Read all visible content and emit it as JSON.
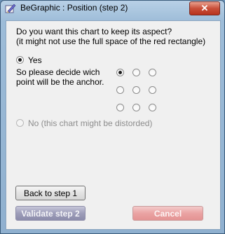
{
  "window": {
    "title": "BeGraphic : Position (step 2)",
    "close_label": "✕"
  },
  "question": {
    "line1": "Do you want this chart to keep its aspect?",
    "line2": "(it might not use the full space of the red rectangle)"
  },
  "options": {
    "yes_label": "Yes",
    "yes_selected": true,
    "anchor_prompt_line1": "So please decide wich",
    "anchor_prompt_line2": "point will be the anchor.",
    "anchor_selected": "top-left",
    "no_label": "No (this chart might be distorded)",
    "no_enabled": false
  },
  "buttons": {
    "back_label": "Back to step 1",
    "validate_label": "Validate step 2",
    "cancel_label": "Cancel"
  },
  "colors": {
    "validate_button": "#9d9db9",
    "cancel_button": "#eaa3a3"
  }
}
